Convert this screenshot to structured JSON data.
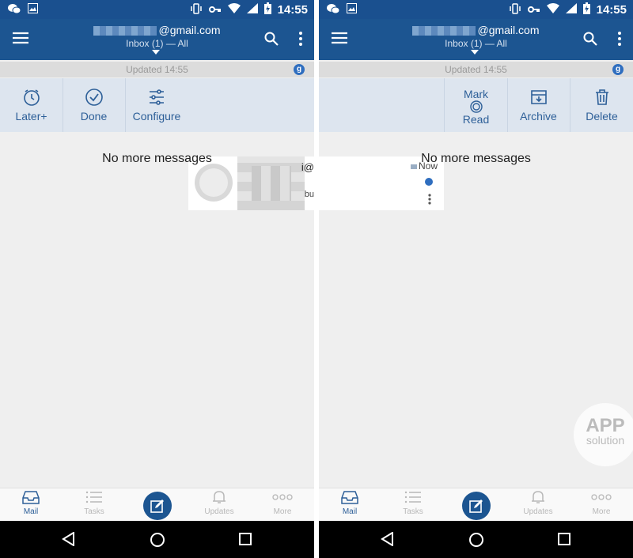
{
  "status": {
    "time": "14:55",
    "battery_icon": "battery-charging-icon"
  },
  "header": {
    "email_domain": "@gmail.com",
    "folder": "Inbox (1) — All"
  },
  "updated": {
    "text": "Updated 14:55",
    "badge": "g"
  },
  "left_actions": [
    {
      "label": "Later+",
      "icon": "clock-icon"
    },
    {
      "label": "Done",
      "icon": "check-circle-icon"
    },
    {
      "label": "Configure",
      "icon": "sliders-icon"
    }
  ],
  "left_peek": {
    "edge_top": "i@",
    "edge_bottom": "bu"
  },
  "right_peek": {
    "time": "Now"
  },
  "right_actions": [
    {
      "label_top": "Mark",
      "label_bottom": "Read",
      "icon": "mark-read-icon"
    },
    {
      "label": "Archive",
      "icon": "archive-icon"
    },
    {
      "label": "Delete",
      "icon": "trash-icon"
    }
  ],
  "empty_message": "No more messages",
  "bottom_nav": [
    {
      "label": "Mail",
      "icon": "inbox-icon",
      "active": true
    },
    {
      "label": "Tasks",
      "icon": "list-icon"
    },
    {
      "label": "",
      "icon": "compose-icon"
    },
    {
      "label": "Updates",
      "icon": "bell-icon"
    },
    {
      "label": "More",
      "icon": "more-dots-icon"
    }
  ],
  "watermark": {
    "line1": "APP",
    "line2": "solution"
  },
  "colors": {
    "primary": "#1c5591",
    "accent": "#2d5f98",
    "badge": "#2f6ebf"
  }
}
